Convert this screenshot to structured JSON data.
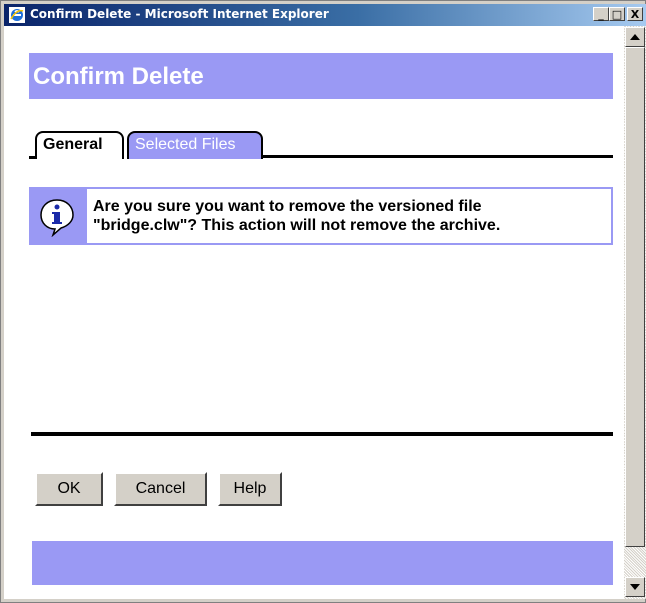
{
  "window": {
    "title": "Confirm Delete - Microsoft Internet Explorer",
    "minimize_label": "_",
    "maximize_label": "□",
    "close_label": "X"
  },
  "page": {
    "title": "Confirm Delete"
  },
  "tabs": [
    {
      "label": "General",
      "active": true
    },
    {
      "label": "Selected Files",
      "active": false
    }
  ],
  "message": {
    "icon": "info-icon",
    "line1": "Are you sure you want to remove the versioned file",
    "line2": "\"bridge.clw\"? This action will not remove the archive."
  },
  "buttons": {
    "ok": "OK",
    "cancel": "Cancel",
    "help": "Help"
  },
  "colors": {
    "accent": "#9a99f4",
    "titlebar_start": "#0a246a",
    "titlebar_end": "#a6caf0"
  }
}
